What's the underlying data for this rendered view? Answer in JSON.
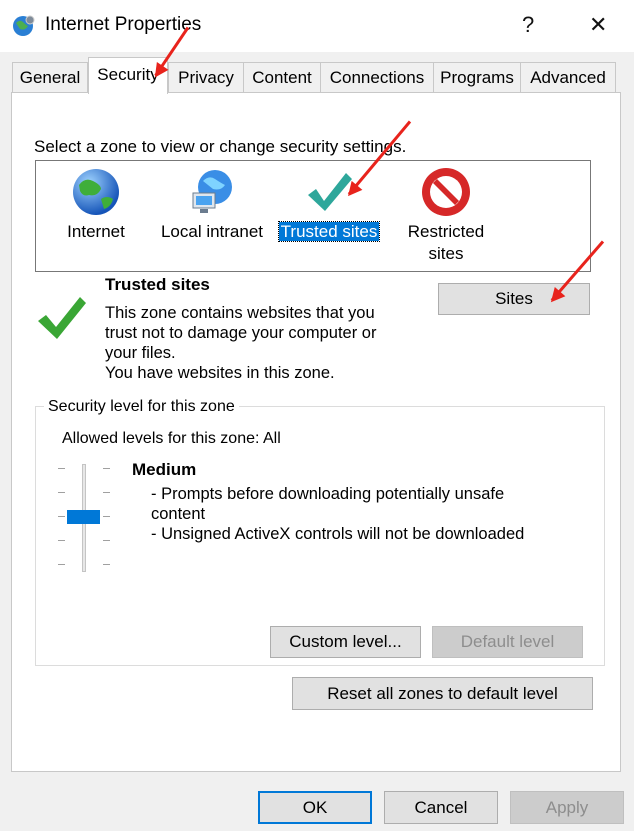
{
  "window": {
    "title": "Internet Properties",
    "help_label": "?",
    "close_label": "✕"
  },
  "tabs": [
    "General",
    "Security",
    "Privacy",
    "Content",
    "Connections",
    "Programs",
    "Advanced"
  ],
  "active_tab": "Security",
  "security": {
    "zone_prompt": "Select a zone to view or change security settings.",
    "zones": [
      {
        "label": "Internet",
        "icon": "globe-icon"
      },
      {
        "label": "Local intranet",
        "icon": "network-globe-icon"
      },
      {
        "label": "Trusted sites",
        "icon": "checkmark-icon"
      },
      {
        "label": "Restricted",
        "label2": "sites",
        "icon": "no-entry-icon"
      }
    ],
    "selected_zone": "Trusted sites",
    "zone_title": "Trusted sites",
    "zone_desc": [
      "This zone contains websites that you",
      "trust not to damage your computer or",
      "your files.",
      "You have websites in this zone."
    ],
    "sites_button": "Sites",
    "level_group_label": "Security level for this zone",
    "allowed_levels": "Allowed levels for this zone: All",
    "level_name": "Medium",
    "level_desc": [
      "- Prompts before downloading potentially unsafe",
      "content",
      "- Unsigned ActiveX controls will not be downloaded"
    ],
    "custom_level_button": "Custom level...",
    "default_level_button": "Default level",
    "reset_button": "Reset all zones to default level"
  },
  "footer": {
    "ok": "OK",
    "cancel": "Cancel",
    "apply": "Apply"
  },
  "colors": {
    "accent": "#0078d7",
    "annotation_arrow": "#e8231c",
    "check_green": "#3aa635"
  }
}
